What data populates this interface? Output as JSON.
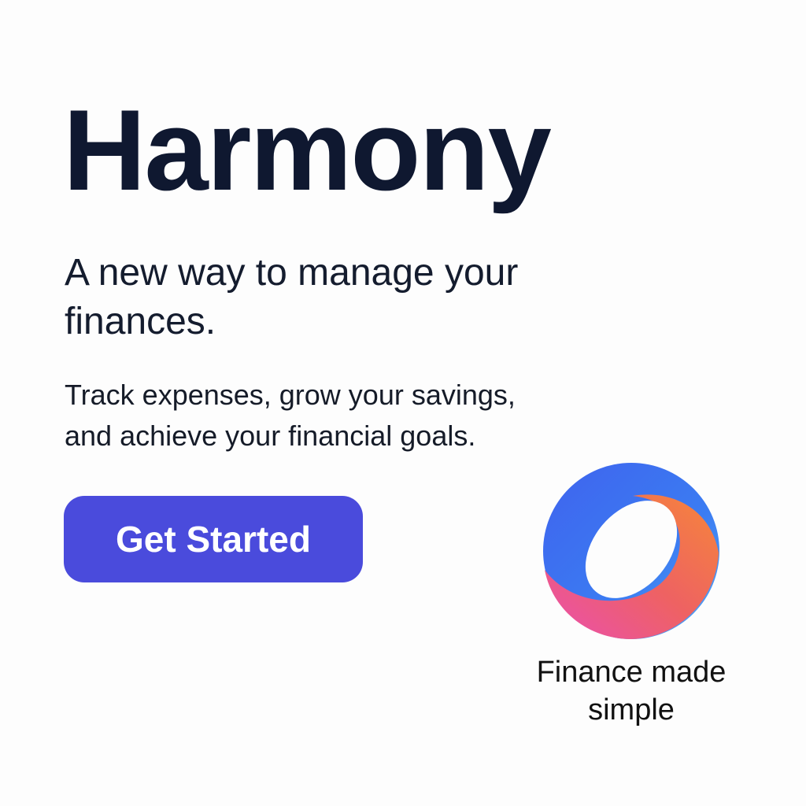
{
  "hero": {
    "title": "Harmony",
    "headline": "A new way to manage your finances.",
    "description": "Track expenses, grow your savings, and achieve your financial goals.",
    "cta_label": "Get Started"
  },
  "logo": {
    "icon": "ring-logo-icon",
    "tagline": "Finance made simple",
    "colors": {
      "blue": "#3b6ff0",
      "light_blue": "#4a9af0",
      "orange": "#f6743a",
      "pink": "#ef5aa8"
    }
  },
  "colors": {
    "background": "#fdfdfd",
    "title": "#0f1830",
    "button": "#4a4bdc",
    "button_text": "#ffffff"
  }
}
